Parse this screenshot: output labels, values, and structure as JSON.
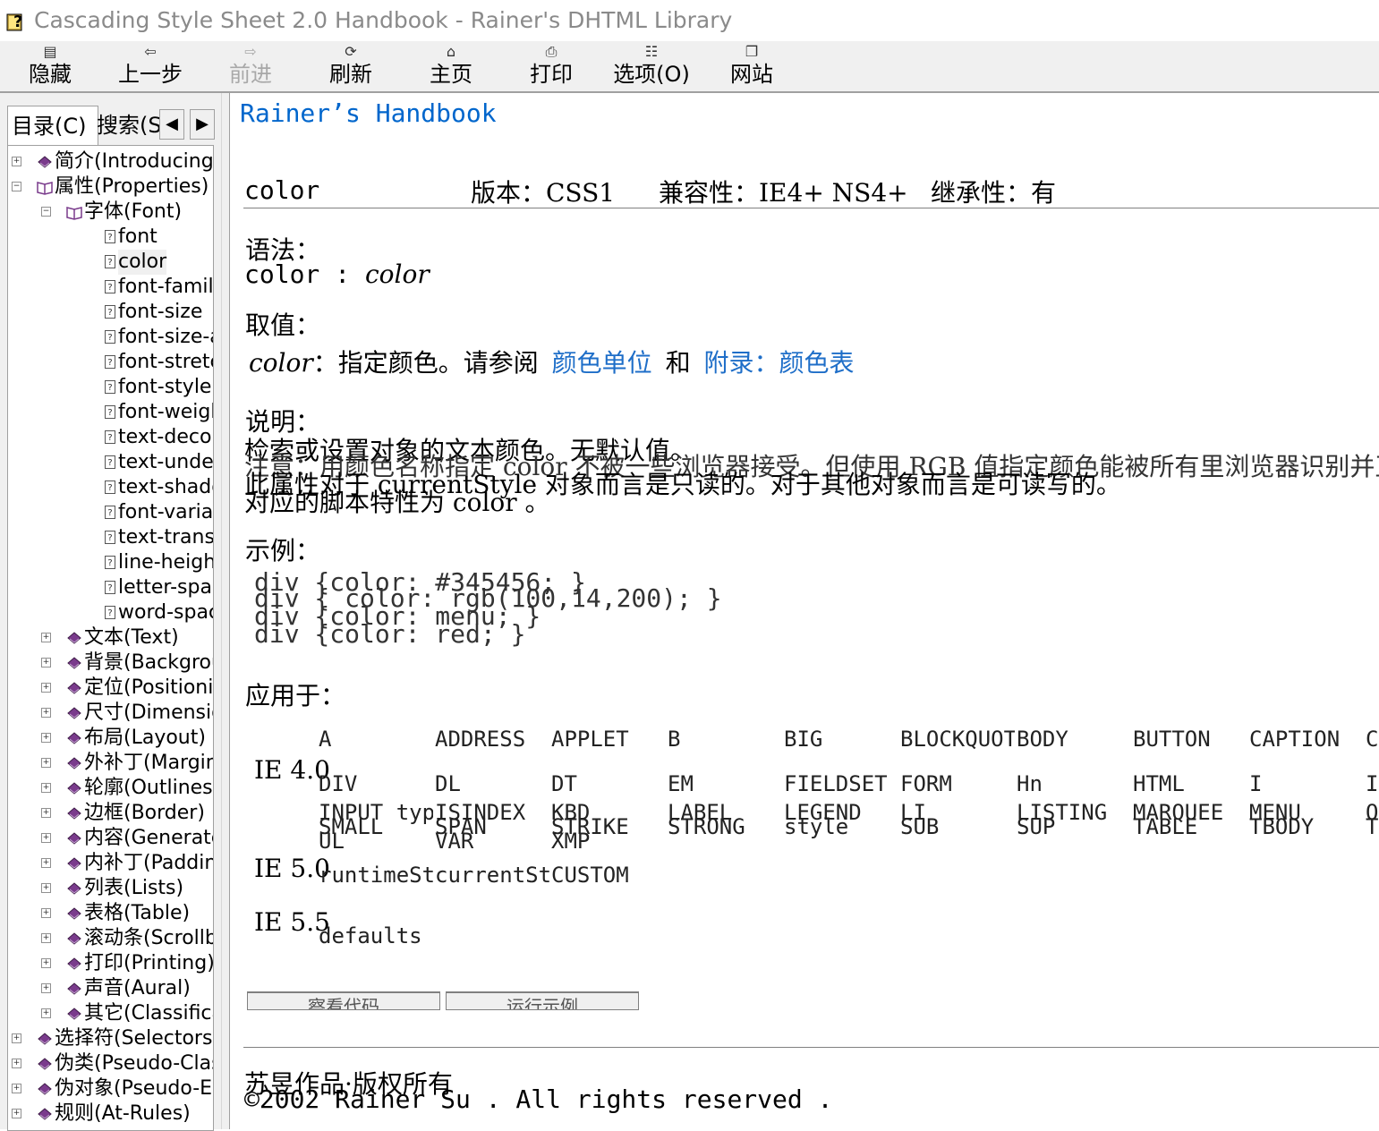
{
  "window": {
    "title": "Cascading Style Sheet 2.0 Handbook - Rainer's DHTML Library",
    "icon": "help-book-icon"
  },
  "toolbar": {
    "hide": {
      "label": "隐藏",
      "icon": "hide-icon"
    },
    "back": {
      "label": "上一步",
      "icon": "back-icon"
    },
    "forward": {
      "label": "前进",
      "icon": "forward-icon"
    },
    "refresh": {
      "label": "刷新",
      "icon": "refresh-icon"
    },
    "home": {
      "label": "主页",
      "icon": "home-icon"
    },
    "print": {
      "label": "打印",
      "icon": "print-icon"
    },
    "options": {
      "label": "选项(O)",
      "icon": "options-icon"
    },
    "web": {
      "label": "网站",
      "icon": "web-icon"
    }
  },
  "nav": {
    "tab_contents": "目录(C)",
    "tab_search": "搜索(S",
    "tree": [
      {
        "label": "简介(Introducing)",
        "type": "book",
        "expanded": false
      },
      {
        "label": "属性(Properties)",
        "type": "book-open",
        "expanded": true
      },
      {
        "label": "字体(Font)",
        "type": "book-open",
        "expanded": true
      },
      {
        "label": "font",
        "type": "page"
      },
      {
        "label": "color",
        "type": "page",
        "selected": true
      },
      {
        "label": "font-family",
        "type": "page"
      },
      {
        "label": "font-size",
        "type": "page"
      },
      {
        "label": "font-size-ad",
        "type": "page"
      },
      {
        "label": "font-stretch",
        "type": "page"
      },
      {
        "label": "font-style",
        "type": "page"
      },
      {
        "label": "font-weight",
        "type": "page"
      },
      {
        "label": "text-decora",
        "type": "page"
      },
      {
        "label": "text-underl",
        "type": "page"
      },
      {
        "label": "text-shadow",
        "type": "page"
      },
      {
        "label": "font-variant",
        "type": "page"
      },
      {
        "label": "text-transfo",
        "type": "page"
      },
      {
        "label": "line-height",
        "type": "page"
      },
      {
        "label": "letter-spaci",
        "type": "page"
      },
      {
        "label": "word-spaci",
        "type": "page"
      },
      {
        "label": "文本(Text)",
        "type": "book"
      },
      {
        "label": "背景(Backgrou",
        "type": "book"
      },
      {
        "label": "定位(Positionin",
        "type": "book"
      },
      {
        "label": "尺寸(Dimensio",
        "type": "book"
      },
      {
        "label": "布局(Layout)",
        "type": "book"
      },
      {
        "label": "外补丁(Margin",
        "type": "book"
      },
      {
        "label": "轮廓(Outlines)",
        "type": "book"
      },
      {
        "label": "边框(Border)",
        "type": "book"
      },
      {
        "label": "内容(Generate",
        "type": "book"
      },
      {
        "label": "内补丁(Paddin",
        "type": "book"
      },
      {
        "label": "列表(Lists)",
        "type": "book"
      },
      {
        "label": "表格(Table)",
        "type": "book"
      },
      {
        "label": "滚动条(Scrollba",
        "type": "book"
      },
      {
        "label": "打印(Printing)",
        "type": "book"
      },
      {
        "label": "声音(Aural)",
        "type": "book"
      },
      {
        "label": "其它(Classifica",
        "type": "book"
      },
      {
        "label": "选择符(Selectors)",
        "type": "book"
      },
      {
        "label": "伪类(Pseudo-Class",
        "type": "book"
      },
      {
        "label": "伪对象(Pseudo-Ele",
        "type": "book"
      },
      {
        "label": "规则(At-Rules)",
        "type": "book"
      }
    ]
  },
  "doc": {
    "header": "Rainer’s Handbook",
    "prop_name": "color",
    "version": "版本：CSS1",
    "compat": "兼容性：IE4+ NS4+",
    "inherit": "继承性：有",
    "syntax_label": "语法：",
    "syntax_prop": "color",
    "syntax_sep": ":",
    "syntax_val": "color",
    "values_label": "取值：",
    "value_term": "color",
    "value_desc": "：指定颜色。请参阅",
    "value_link1": "颜色单位",
    "value_and": "和",
    "value_link2": "附录：颜色表",
    "desc_label": "说明：",
    "desc_line1": "检索或设置对象的文本颜色。无默认值。",
    "note_line": "注意：用颜色名称指定 color 不被一些浏览器接受。但使用 RGB 值指定颜色能被所有里浏览器识别并正确显示。",
    "desc_line2": "此属性对于 currentStyle 对象而言是只读的。对于其他对象而言是可读写的。",
    "desc_line3": "对应的脚本特性为 color 。",
    "example_label": "示例：",
    "examples": [
      "div {color: #345456; }",
      "div { color: rgb(100,14,200); }",
      "div {color: menu; }",
      "div {color: red; }"
    ],
    "applies_label": "应用于：",
    "versions": [
      "IE 4.0",
      "IE 5.0",
      "IE 5.5"
    ],
    "ie4_row1": [
      "A",
      "ADDRESS",
      "APPLET",
      "B",
      "BIG",
      "BLOCKQUOTE",
      "BODY",
      "BUTTON",
      "CAPTION",
      "C"
    ],
    "ie4_row2": [
      "DIV",
      "DL",
      "DT",
      "EM",
      "FIELDSET",
      "FORM",
      "Hn",
      "HTML",
      "I",
      "I"
    ],
    "ie4_row3": [
      "INPUT type=text",
      "ISINDEX",
      "KBD",
      "LABEL",
      "LEGEND",
      "LI",
      "LISTING",
      "MARQUEE",
      "MENU",
      "O"
    ],
    "ie4_row4": [
      "SMALL",
      "SPAN",
      "STRIKE",
      "STRONG",
      "style",
      "SUB",
      "SUP",
      "TABLE",
      "TBODY",
      "T"
    ],
    "ie4_row5": [
      "UL",
      "VAR",
      "XMP"
    ],
    "ie5_row": [
      "runtimeStyle",
      "currentStyle",
      "CUSTOM"
    ],
    "ie55_row": [
      "defaults"
    ],
    "btn_view": "察看代码",
    "btn_run": "运行示例",
    "footer_author": "苏昱作品·版权所有",
    "footer_copy": "©2002 Rainer Su . All rights reserved ."
  }
}
